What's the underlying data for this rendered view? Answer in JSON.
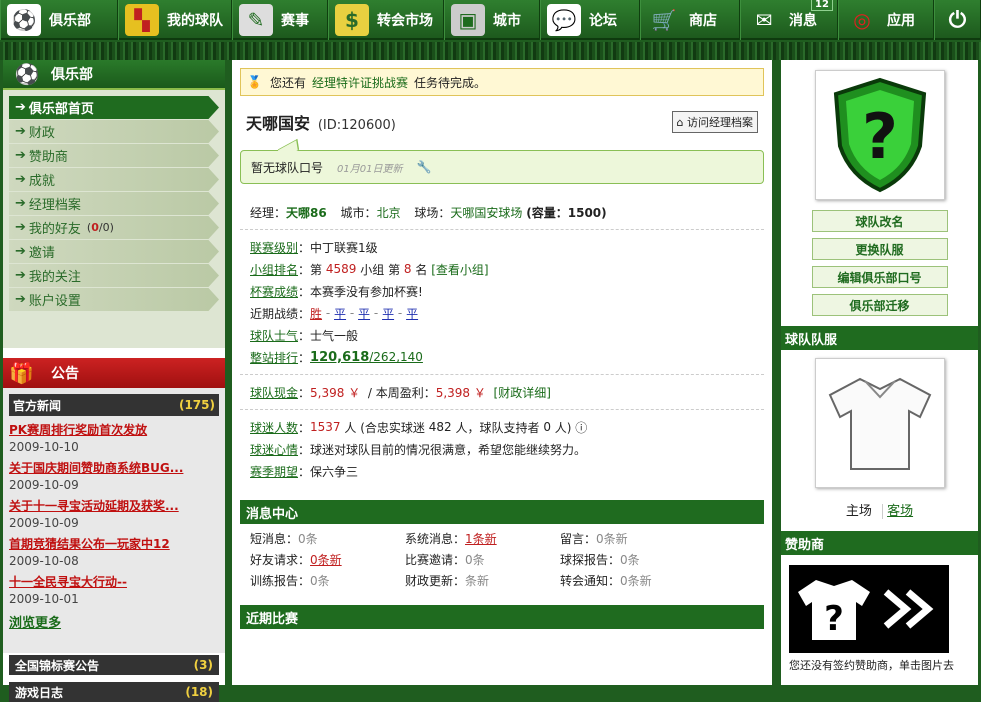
{
  "nav": {
    "items": [
      {
        "label": "俱乐部",
        "icon": "club-icon"
      },
      {
        "label": "我的球队",
        "icon": "team-icon"
      },
      {
        "label": "赛事",
        "icon": "match-icon"
      },
      {
        "label": "转会市场",
        "icon": "money-bag-icon"
      },
      {
        "label": "城市",
        "icon": "stadium-icon"
      },
      {
        "label": "论坛",
        "icon": "chat-icon"
      },
      {
        "label": "商店",
        "icon": "cart-icon"
      },
      {
        "label": "消息",
        "icon": "mail-icon",
        "badge": "12"
      },
      {
        "label": "应用",
        "icon": "target-icon"
      }
    ]
  },
  "left": {
    "header": "俱乐部",
    "menu": [
      {
        "label": "俱乐部首页",
        "active": true
      },
      {
        "label": "财政"
      },
      {
        "label": "赞助商"
      },
      {
        "label": "成就"
      },
      {
        "label": "经理档案"
      },
      {
        "label": "我的好友",
        "extra_a": "0",
        "extra_b": "0"
      },
      {
        "label": "邀请"
      },
      {
        "label": "我的关注"
      },
      {
        "label": "账户设置"
      }
    ],
    "announce_header": "公告",
    "news_header": "官方新闻",
    "news_count": "(175)",
    "news": [
      {
        "title": "PK赛周排行奖励首次发放",
        "date": "2009-10-10"
      },
      {
        "title": "关于国庆期间赞助商系统BUG...",
        "date": "2009-10-09"
      },
      {
        "title": "关于十一寻宝活动延期及获奖...",
        "date": "2009-10-09"
      },
      {
        "title": "首期竞猜结果公布一玩家中12",
        "date": "2009-10-08"
      },
      {
        "title": "十一全民寻宝大行动--",
        "date": "2009-10-01"
      }
    ],
    "more": "浏览更多",
    "sub1": {
      "label": "全国锦标赛公告",
      "count": "(3)"
    },
    "sub2": {
      "label": "游戏日志",
      "count": "(18)"
    }
  },
  "main": {
    "notice_pre": "您还有",
    "notice_link": "经理特许证挑战赛",
    "notice_post": "任务待完成。",
    "team_name": "天哪国安",
    "team_id": "(ID:120600)",
    "visit_btn": "访问经理档案",
    "slogan": "暂无球队口号",
    "slogan_updated": "01月01日更新",
    "manager_k": "经理：",
    "manager": "天哪86",
    "city_k": "城市：",
    "city": "北京",
    "stadium_k": "球场：",
    "stadium": "天哪国安球场",
    "capacity": "(容量：1500)",
    "league_k": "联赛级别",
    "league": "中丁联赛1级",
    "group_k": "小组排名",
    "group_a": "第",
    "group_rank": "4589",
    "group_b": "小组 第",
    "group_pos": "8",
    "group_c": "名",
    "group_link": "[查看小组]",
    "cup_k": "杯赛成绩",
    "cup": "本赛季没有参加杯赛!",
    "recent_k": "近期战绩：",
    "recent": [
      "胜",
      "平",
      "平",
      "平",
      "平"
    ],
    "morale_k": "球队士气",
    "morale": "士气一般",
    "site_rank_k": "整站排行",
    "site_rank": "120,618",
    "site_total": "/262,140",
    "cash_k": "球队现金",
    "cash": "5,398 ￥",
    "profit_k": "/ 本周盈利：",
    "profit": "5,398 ￥",
    "finance_link": "[财政详细]",
    "fans_k": "球迷人数",
    "fans": "1537",
    "fans_rest_a": "人 (合忠实球迷",
    "loyal": "482",
    "fans_rest_b": "人，球队支持者",
    "supporters": "0",
    "fans_rest_c": "人)",
    "mood_k": "球迷心情",
    "mood": "球迷对球队目前的情况很满意，希望您能继续努力。",
    "expect_k": "赛季期望",
    "expect": "保六争三",
    "msg_header": "消息中心",
    "msgs": [
      {
        "k": "短消息：",
        "v": "0条",
        "hot": false
      },
      {
        "k": "系统消息：",
        "v": "1条新",
        "hot": true
      },
      {
        "k": "留言：",
        "v": "0条新",
        "hot": false
      },
      {
        "k": "好友请求：",
        "v": "0条新",
        "hot": true
      },
      {
        "k": "比赛邀请：",
        "v": "0条",
        "hot": false
      },
      {
        "k": "球探报告：",
        "v": "0条",
        "hot": false
      },
      {
        "k": "训练报告：",
        "v": "0条",
        "hot": false
      },
      {
        "k": "财政更新：",
        "v": "条新",
        "hot": false
      },
      {
        "k": "转会通知：",
        "v": "0条新",
        "hot": false
      }
    ],
    "recent_header": "近期比赛"
  },
  "right": {
    "buttons": [
      "球队改名",
      "更换队服",
      "编辑俱乐部口号",
      "俱乐部迁移"
    ],
    "kit_header": "球队队服",
    "home": "主场",
    "away": "客场",
    "sponsor_header": "赞助商",
    "sponsor_text": "您还没有签约赞助商，单击图片去"
  },
  "colors": {
    "brand_green": "#1f6b1f",
    "alert_red": "#c02020"
  }
}
